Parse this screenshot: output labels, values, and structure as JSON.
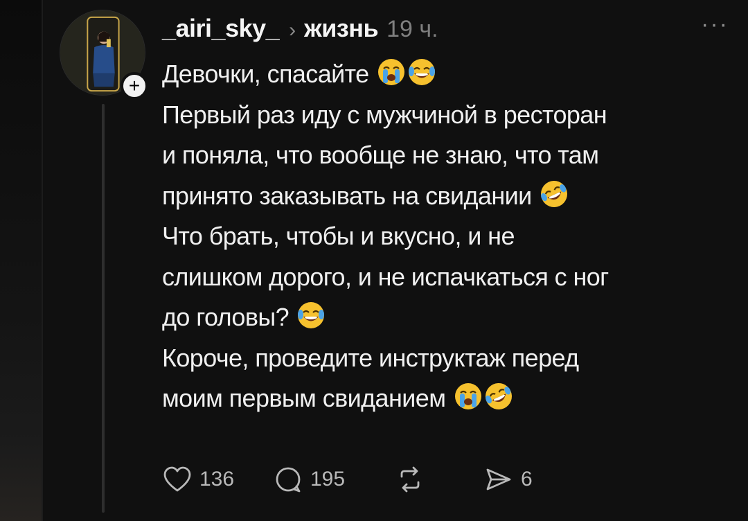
{
  "post": {
    "username": "_airi_sky_",
    "community": "жизнь",
    "timestamp": "19 ч.",
    "more_label": "···",
    "follow_label": "+",
    "body_lines": [
      "Девочки, спасайте",
      "Первый раз иду с мужчиной в ресторан",
      "и поняла, что вообще не знаю, что там",
      "принято заказывать на свидании",
      "Что брать, чтобы и вкусно, и не",
      "слишком дорого, и не испачкаться с ног",
      "до головы?",
      "Короче, проведите инструктаж перед",
      "моим первым свиданием"
    ],
    "emojis": {
      "line1": [
        "loudly-crying-face",
        "face-with-tears-of-joy"
      ],
      "line4": [
        "rolling-on-the-floor-laughing"
      ],
      "line7": [
        "face-with-tears-of-joy"
      ],
      "line9": [
        "loudly-crying-face",
        "rolling-on-the-floor-laughing"
      ]
    }
  },
  "actions": {
    "likes": "136",
    "replies": "195",
    "reposts": "",
    "shares": "6"
  },
  "colors": {
    "background": "#101010",
    "text": "#f0f0f0",
    "muted": "#7f7f7f",
    "emoji_yellow": "#f6c12e",
    "emoji_blue": "#4aa3e8"
  }
}
